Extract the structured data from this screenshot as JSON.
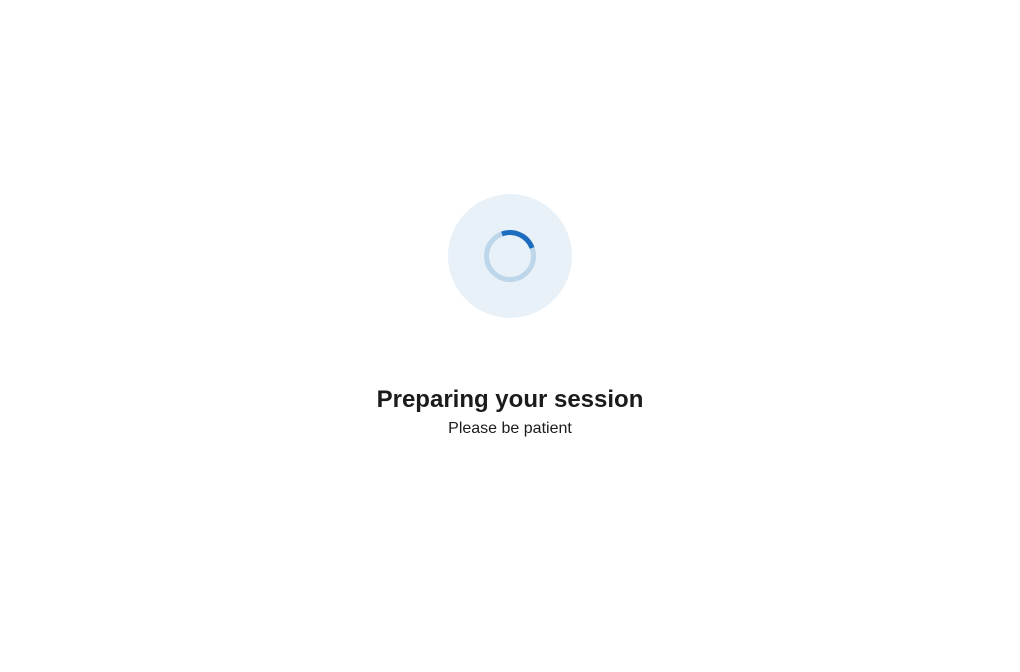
{
  "loading": {
    "title": "Preparing your session",
    "subtitle": "Please be patient"
  }
}
